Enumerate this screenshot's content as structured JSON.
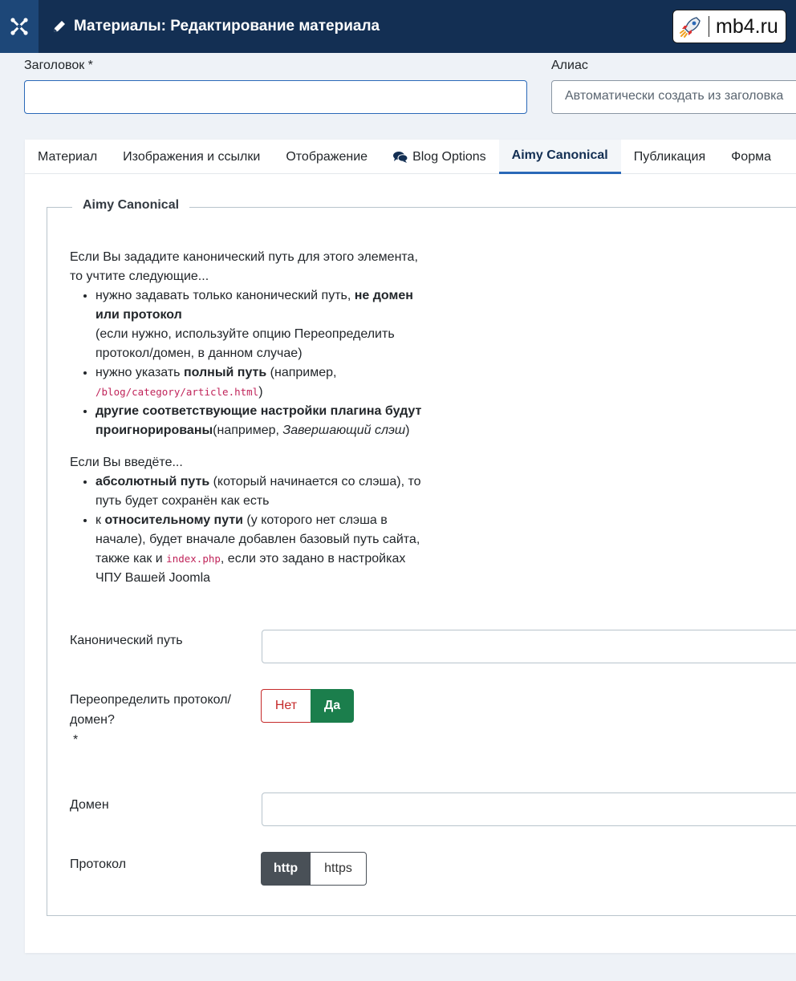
{
  "header": {
    "title": "Материалы: Редактирование материала",
    "brand": "mb4.ru"
  },
  "fields_top": {
    "title_label": "Заголовок *",
    "title_value": "",
    "alias_label": "Алиас",
    "alias_placeholder": "Автоматически создать из заголовка"
  },
  "tabs": [
    {
      "label": "Материал"
    },
    {
      "label": "Изображения и ссылки"
    },
    {
      "label": "Отображение"
    },
    {
      "label": "Blog Options"
    },
    {
      "label": "Aimy Canonical",
      "active": true
    },
    {
      "label": "Публикация"
    },
    {
      "label": "Форма"
    }
  ],
  "fieldset": {
    "legend": "Aimy Canonical",
    "p1": "Если Вы зададите канонический путь для этого элемента, то учтите следующие...",
    "b1_a": "нужно задавать только канонический путь, ",
    "b1_b": "не домен или протокол",
    "b1_c": "(если нужно, используйте опцию Переопределить протокол/домен, в данном случае)",
    "b2_a": "нужно указать ",
    "b2_b": "полный путь",
    "b2_c": " (например, ",
    "b2_code": "/blog/category/article.html",
    "b2_d": ")",
    "b3_a": "другие соответствующие настройки плагина будут проигнорированы",
    "b3_b": "(например, ",
    "b3_c": "Завершающий слэш",
    "b3_d": ")",
    "p2": "Если Вы введёте...",
    "c1_a": "абсолютный путь",
    "c1_b": " (который начинается со слэша), то путь будет сохранён как есть",
    "c2_a": "к ",
    "c2_b": "относительному пути",
    "c2_c": " (у которого нет слэша в начале), будет вначале добавлен базовый путь сайта, также как и ",
    "c2_code": "index.php",
    "c2_d": ", если это задано в настройках ЧПУ Вашей Joomla"
  },
  "form": {
    "canonical_label": "Канонический путь",
    "canonical_value": "",
    "override_label": "Переопределить протокол/домен?",
    "override_required": "*",
    "override_no": "Нет",
    "override_yes": "Да",
    "domain_label": "Домен",
    "domain_value": "",
    "protocol_label": "Протокол",
    "protocol_http": "http",
    "protocol_https": "https"
  },
  "colors": {
    "header_bg": "#132f53",
    "accent": "#2a69b8",
    "yes_green": "#1b7e4c",
    "no_red": "#c52a2a",
    "code_pink": "#c0245a"
  }
}
